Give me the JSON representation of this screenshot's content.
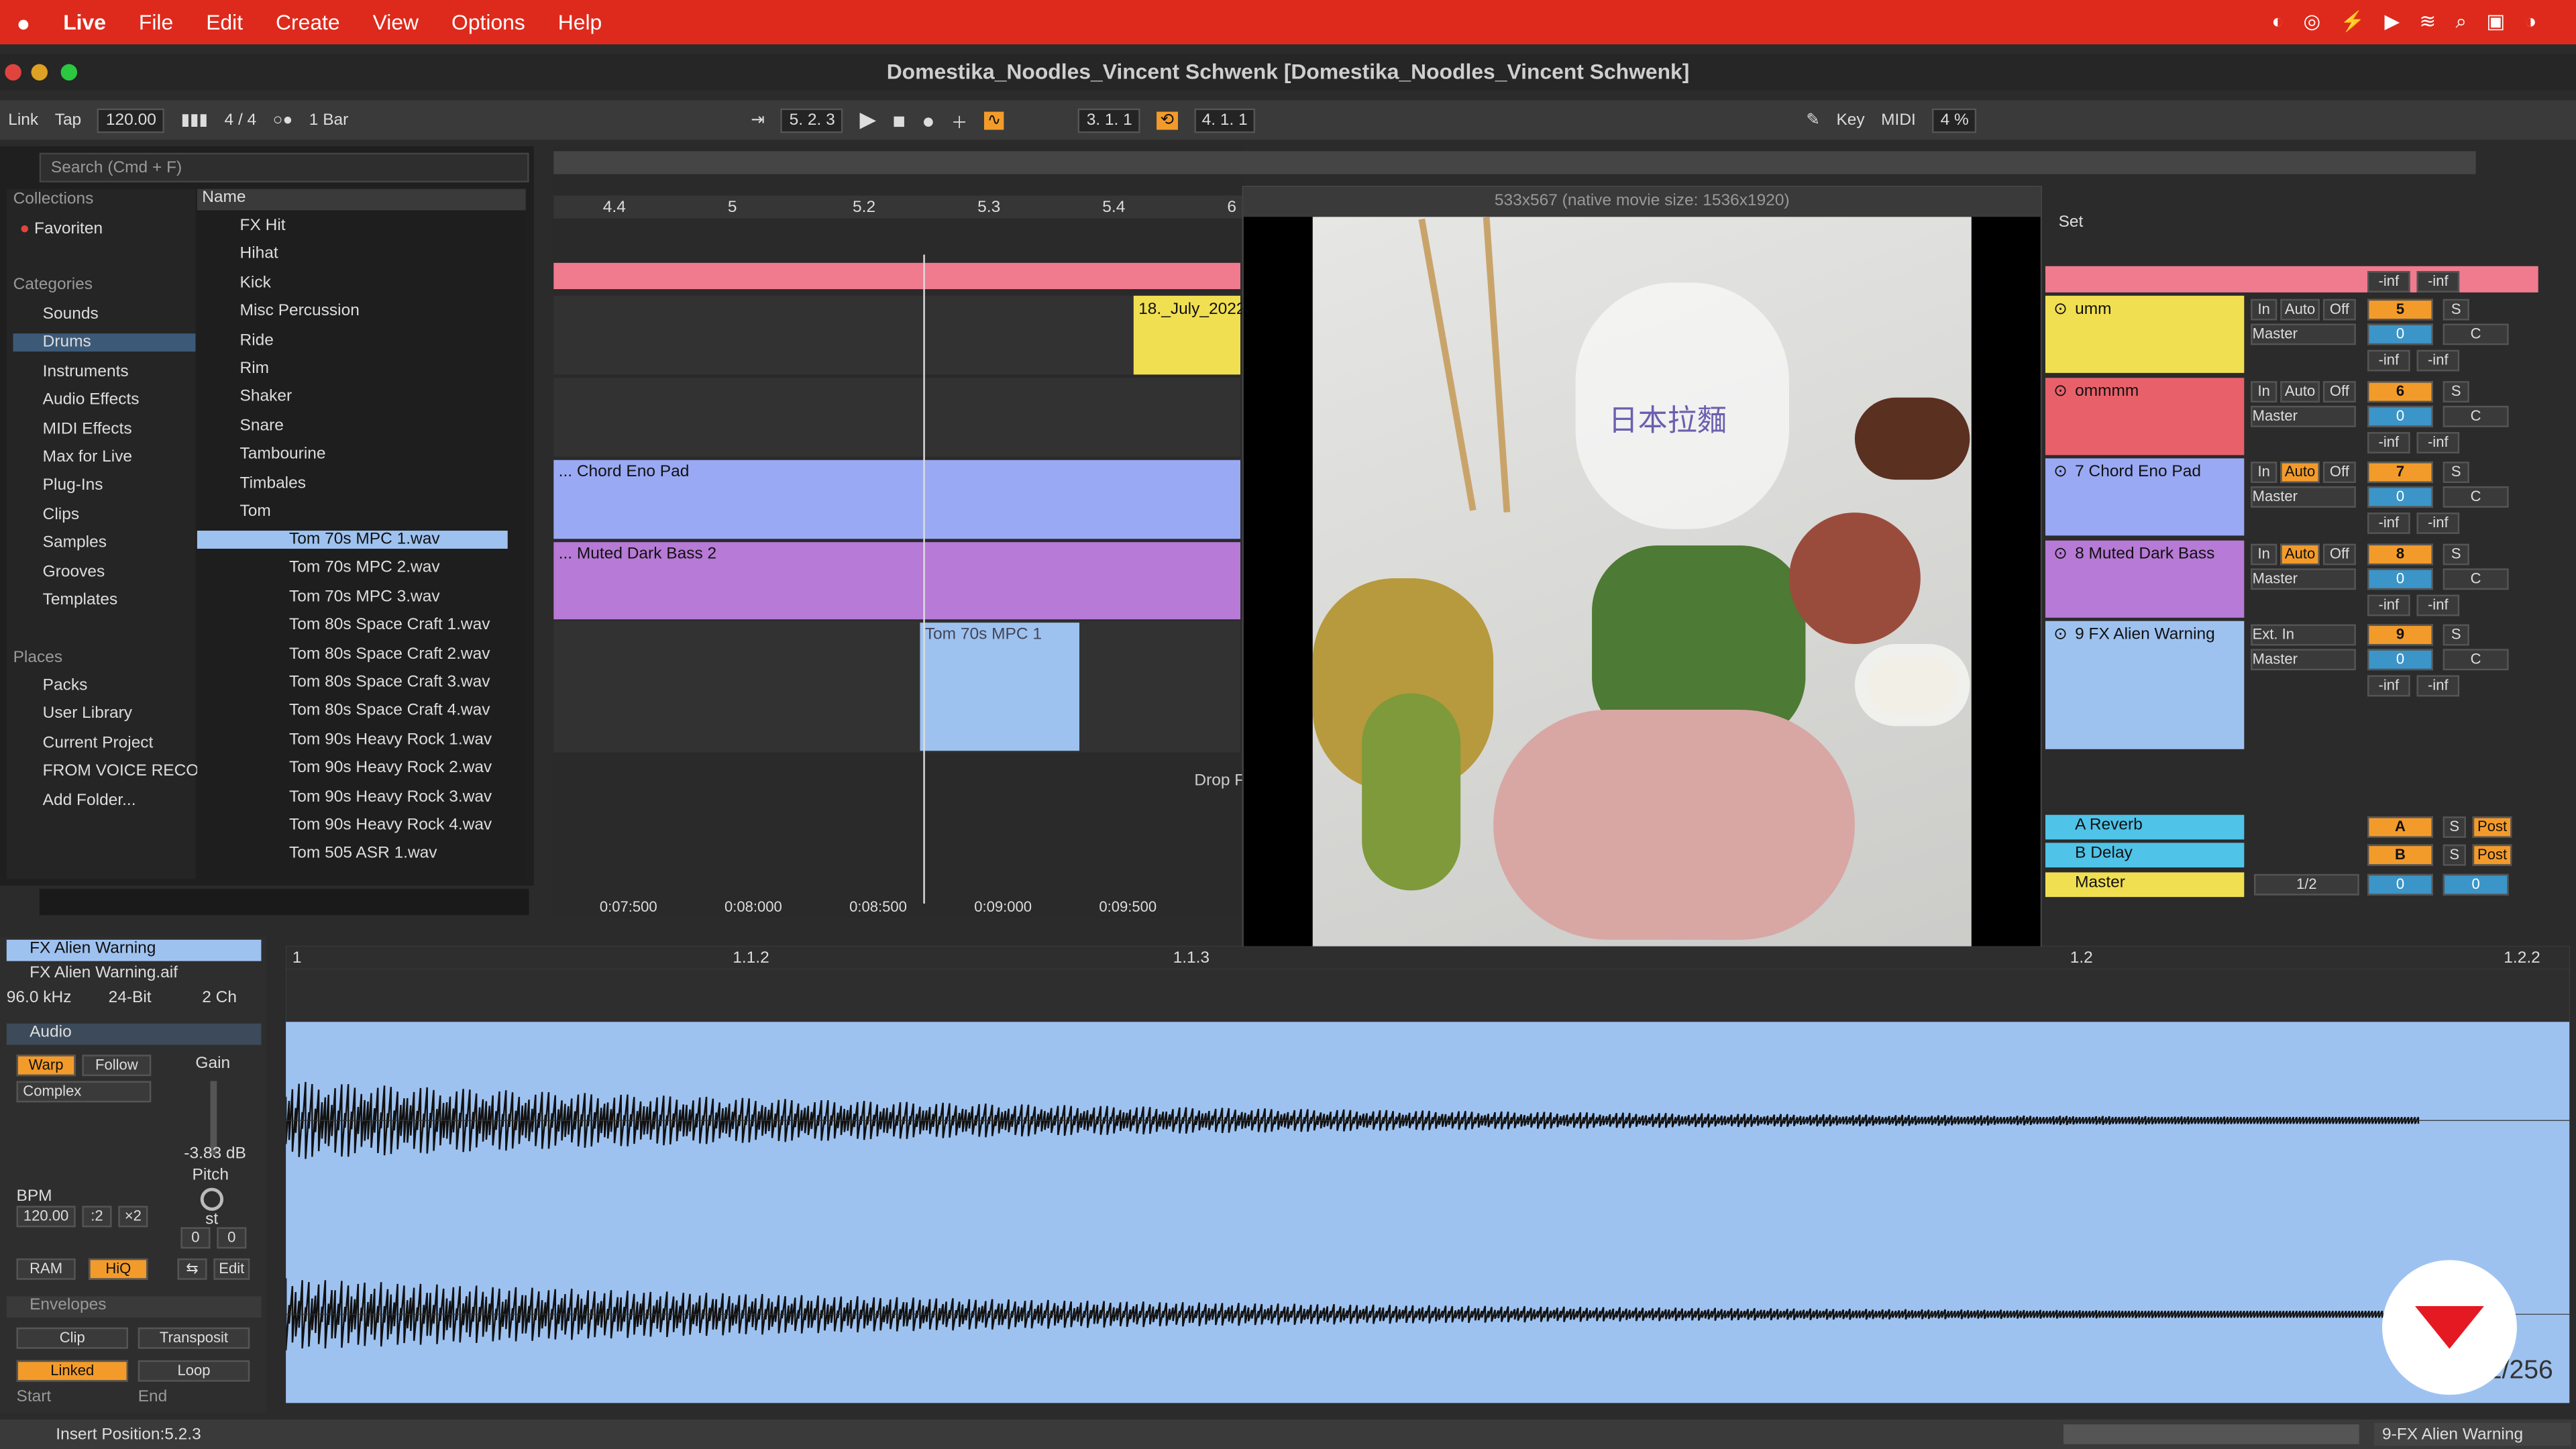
{
  "menubar": {
    "app": "Live",
    "items": [
      "File",
      "Edit",
      "Create",
      "View",
      "Options",
      "Help"
    ]
  },
  "window": {
    "title": "Domestika_Noodles_Vincent Schwenk  [Domestika_Noodles_Vincent Schwenk]"
  },
  "control": {
    "link": "Link",
    "tap": "Tap",
    "tempo": "120.00",
    "signature": "4 / 4",
    "quant": "1 Bar",
    "position": "5.   2.   3",
    "loop_start": "3.   1.   1",
    "loop_len": "4.   1.   1",
    "key": "Key",
    "midi": "MIDI",
    "zoom": "4 %"
  },
  "browser": {
    "search_placeholder": "Search (Cmd + F)",
    "collections_header": "Collections",
    "favorites": "Favoriten",
    "categories_header": "Categories",
    "categories": [
      "Sounds",
      "Drums",
      "Instruments",
      "Audio Effects",
      "MIDI Effects",
      "Max for Live",
      "Plug-Ins",
      "Clips",
      "Samples",
      "Grooves",
      "Templates"
    ],
    "places_header": "Places",
    "places": [
      "Packs",
      "User Library",
      "Current Project",
      "FROM VOICE RECORI",
      "Add Folder..."
    ],
    "name_header": "Name",
    "folders": [
      "FX Hit",
      "Hihat",
      "Kick",
      "Misc Percussion",
      "Ride",
      "Rim",
      "Shaker",
      "Snare",
      "Tambourine",
      "Timbales",
      "Tom"
    ],
    "files": [
      "Tom 70s MPC 1.wav",
      "Tom 70s MPC 2.wav",
      "Tom 70s MPC 3.wav",
      "Tom 80s Space Craft 1.wav",
      "Tom 80s Space Craft 2.wav",
      "Tom 80s Space Craft 3.wav",
      "Tom 80s Space Craft 4.wav",
      "Tom 90s Heavy Rock 1.wav",
      "Tom 90s Heavy Rock 2.wav",
      "Tom 90s Heavy Rock 3.wav",
      "Tom 90s Heavy Rock 4.wav",
      "Tom 505 ASR 1.wav"
    ]
  },
  "arrangement": {
    "ruler": [
      "4.4",
      "5",
      "5.2",
      "5.3",
      "5.4",
      "6"
    ],
    "times": [
      "0:07:500",
      "0:08:000",
      "0:08:500",
      "0:09:000",
      "0:09:500"
    ],
    "clips": {
      "july": "18._July_2022",
      "chord": "... Chord Eno Pad",
      "bass": "... Muted Dark Bass 2",
      "tom": "Tom 70s MPC 1",
      "drop": "Drop F"
    }
  },
  "video": {
    "title": "533x567 (native movie size: 1536x1920)",
    "text1": "日本拉麵",
    "text2": "日本拉麵"
  },
  "mixer": {
    "set": "Set",
    "tracks": [
      {
        "name": "umm",
        "num": "5"
      },
      {
        "name": "ommmm",
        "num": "6"
      },
      {
        "name": "7 Chord Eno Pad",
        "num": "7"
      },
      {
        "name": "8 Muted Dark Bass",
        "num": "8"
      },
      {
        "name": "9 FX Alien Warning",
        "num": "9"
      }
    ],
    "returns": [
      {
        "name": "A Reverb",
        "id": "A"
      },
      {
        "name": "B Delay",
        "id": "B"
      },
      {
        "name": "Master",
        "id": "1/2"
      }
    ],
    "inf": "-inf",
    "master": "Master",
    "in": "In",
    "auto": "Auto",
    "off": "Off",
    "s": "S",
    "c": "C",
    "zero": "0",
    "ext_in": "Ext. In",
    "one": "1",
    "post": "Post"
  },
  "clip": {
    "name": "FX Alien Warning",
    "file": "FX Alien Warning.aif",
    "rate": "96.0 kHz",
    "bits": "24-Bit",
    "ch": "2 Ch",
    "audio": "Audio",
    "warp": "Warp",
    "follow": "Follow",
    "mode": "Complex",
    "gain_label": "Gain",
    "gain": "-3.83 dB",
    "pitch": "Pitch",
    "st": "st",
    "bpm_label": "BPM",
    "bpm": "120.00",
    "half": ":2",
    "double": "×2",
    "ram": "RAM",
    "hiq": "HiQ",
    "edit": "Edit",
    "envelopes": "Envelopes",
    "env_clip": "Clip",
    "env_tr": "Transposit",
    "linked": "Linked",
    "loop": "Loop",
    "start": "Start",
    "end": "End",
    "ruler": [
      "1",
      "1.1.2",
      "1.1.3",
      "1.2",
      "1.2.2"
    ],
    "page": "1/256"
  },
  "status": {
    "insert": "Insert Position:5.2.3",
    "track": "9-FX Alien Warning"
  }
}
